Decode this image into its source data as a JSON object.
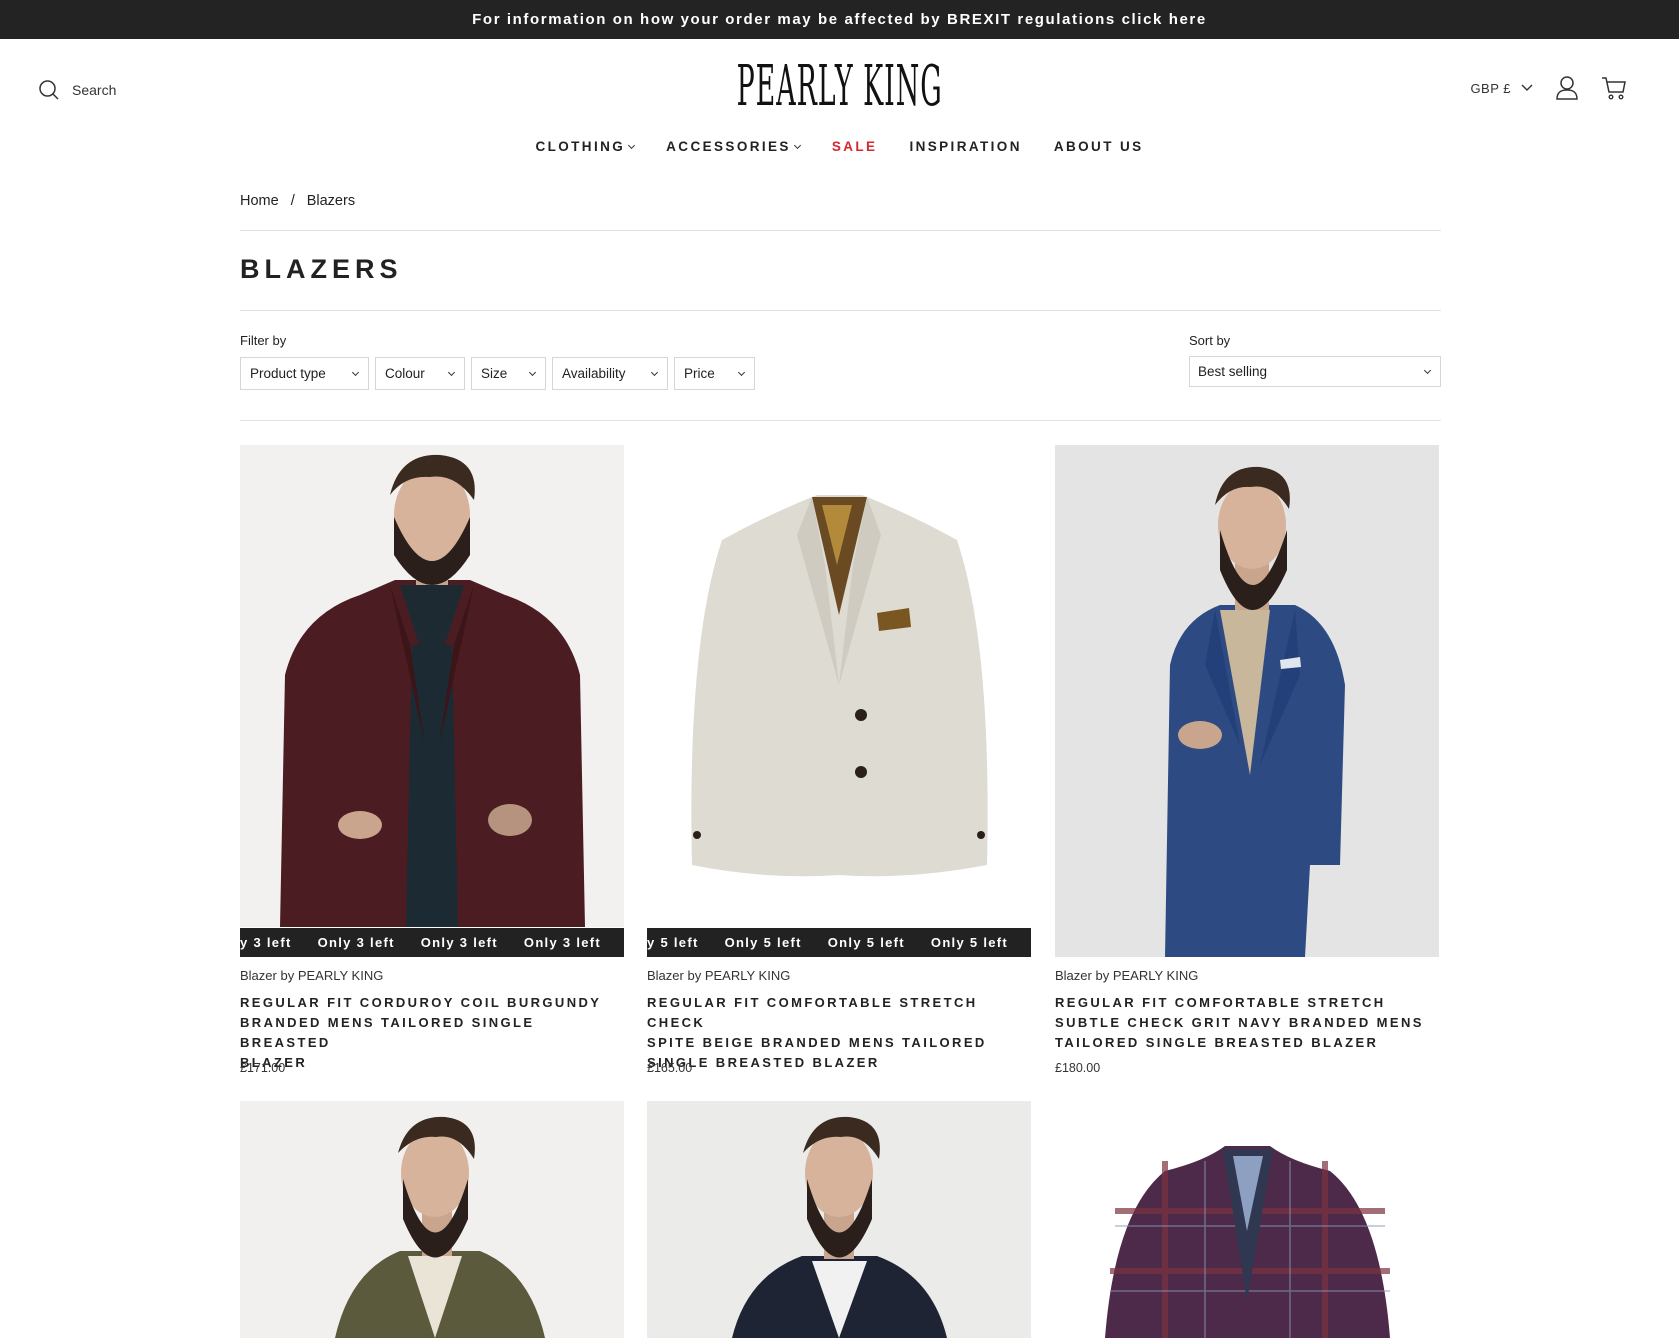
{
  "announcement": "For information on how your order may be affected by BREXIT regulations click here",
  "header": {
    "search_label": "Search",
    "logo": "PEARLY KING",
    "currency": "GBP £"
  },
  "nav": [
    {
      "label": "CLOTHING",
      "dropdown": true
    },
    {
      "label": "ACCESSORIES",
      "dropdown": true
    },
    {
      "label": "SALE",
      "dropdown": false
    },
    {
      "label": "INSPIRATION",
      "dropdown": false
    },
    {
      "label": "ABOUT US",
      "dropdown": false
    }
  ],
  "breadcrumb": {
    "home": "Home",
    "separator": "/",
    "current": "Blazers"
  },
  "page_title": "BLAZERS",
  "filters": {
    "label": "Filter by",
    "items": [
      "Product type",
      "Colour",
      "Size",
      "Availability",
      "Price"
    ]
  },
  "sort": {
    "label": "Sort by",
    "value": "Best selling"
  },
  "products": [
    {
      "vendor_prefix": "Blazer by",
      "vendor": "PEARLY KING",
      "title_lines": [
        "REGULAR FIT CORDUROY COIL BURGUNDY",
        "BRANDED MENS TAILORED SINGLE BREASTED",
        "BLAZER"
      ],
      "price": "£171.00",
      "stock_badge": "Only 3 left",
      "stock_badge_lead": "y 3 left"
    },
    {
      "vendor_prefix": "Blazer by",
      "vendor": "PEARLY KING",
      "title_lines": [
        "REGULAR FIT COMFORTABLE STRETCH CHECK",
        "SPITE BEIGE BRANDED MENS TAILORED",
        "SINGLE BREASTED BLAZER"
      ],
      "price": "£165.00",
      "stock_badge": "Only 5 left",
      "stock_badge_lead": "y 5 left"
    },
    {
      "vendor_prefix": "Blazer by",
      "vendor": "PEARLY KING",
      "title_lines": [
        "REGULAR FIT COMFORTABLE STRETCH",
        "SUBTLE CHECK GRIT NAVY BRANDED MENS",
        "TAILORED SINGLE BREASTED BLAZER"
      ],
      "price": "£180.00",
      "stock_badge": "",
      "stock_badge_lead": ""
    }
  ],
  "colors": {
    "announcement_bg": "#232323",
    "sale": "#d7262c",
    "badge_bg": "#222222"
  }
}
